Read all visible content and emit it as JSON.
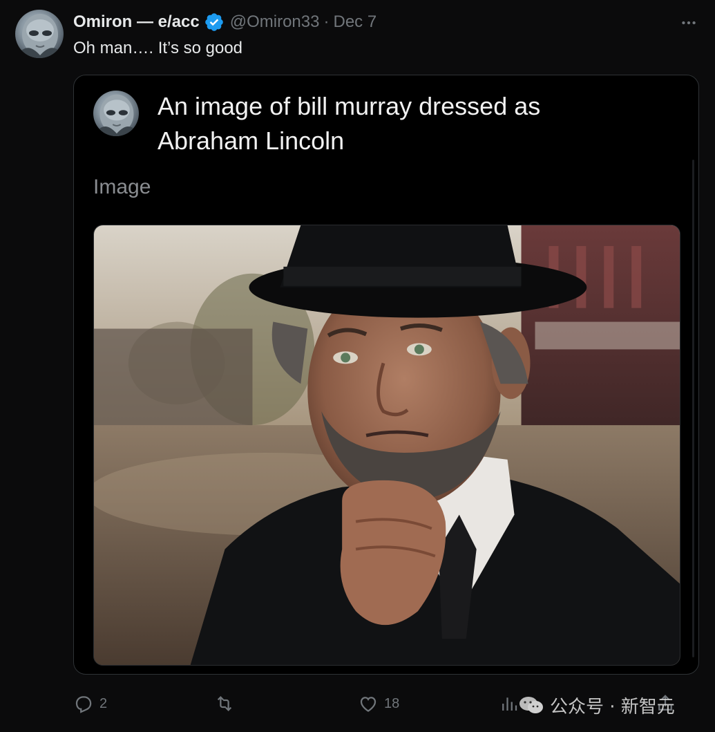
{
  "author": {
    "display_name": "Omiron — e/acc",
    "handle": "@Omiron33",
    "separator": "·",
    "date": "Dec 7"
  },
  "tweet": {
    "text": "Oh man…. It’s so good"
  },
  "quote": {
    "title": "An image of bill murray dressed as Abraham Lincoln",
    "subtitle": "Image"
  },
  "actions": {
    "replies": "2",
    "likes": "18"
  },
  "watermark": {
    "text": "公众号 · 新智元"
  },
  "colors": {
    "background": "#0b0b0c",
    "text_primary": "#e7e9ea",
    "text_secondary": "#71767b",
    "verified_blue": "#1d9bf0",
    "card_border": "#2f3336"
  }
}
